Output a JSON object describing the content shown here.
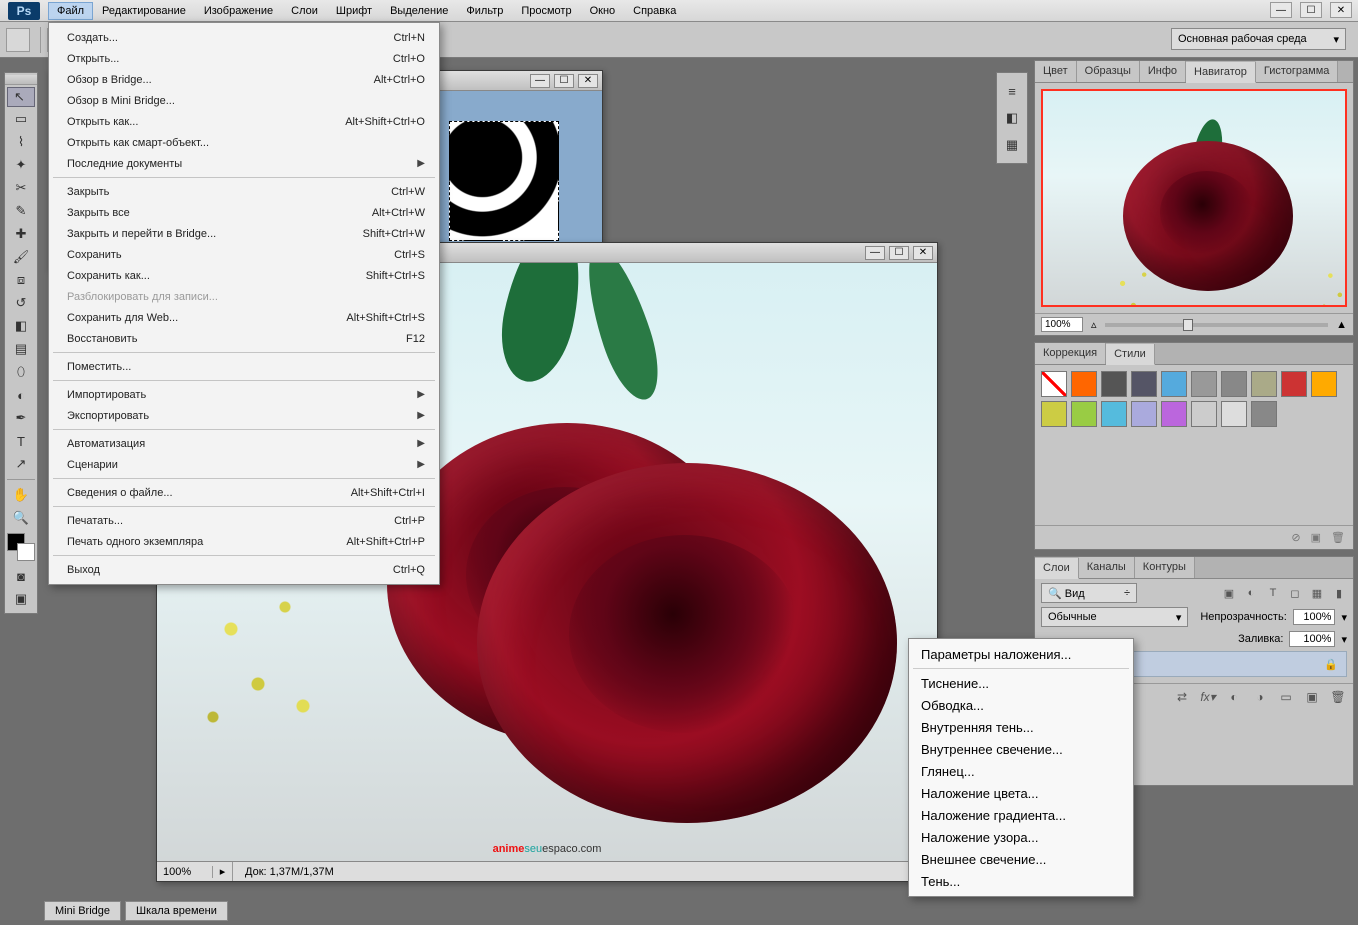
{
  "app": {
    "logo": "Ps"
  },
  "menubar": {
    "items": [
      "Файл",
      "Редактирование",
      "Изображение",
      "Слои",
      "Шрифт",
      "Выделение",
      "Фильтр",
      "Просмотр",
      "Окно",
      "Справка"
    ]
  },
  "workspace_selector": "Основная рабочая среда",
  "file_menu": [
    {
      "label": "Создать...",
      "shortcut": "Ctrl+N"
    },
    {
      "label": "Открыть...",
      "shortcut": "Ctrl+O"
    },
    {
      "label": "Обзор в Bridge...",
      "shortcut": "Alt+Ctrl+O"
    },
    {
      "label": "Обзор в Mini Bridge...",
      "shortcut": ""
    },
    {
      "label": "Открыть как...",
      "shortcut": "Alt+Shift+Ctrl+O"
    },
    {
      "label": "Открыть как смарт-объект...",
      "shortcut": ""
    },
    {
      "label": "Последние документы",
      "shortcut": "",
      "submenu": true
    },
    {
      "sep": true
    },
    {
      "label": "Закрыть",
      "shortcut": "Ctrl+W"
    },
    {
      "label": "Закрыть все",
      "shortcut": "Alt+Ctrl+W"
    },
    {
      "label": "Закрыть и перейти в Bridge...",
      "shortcut": "Shift+Ctrl+W"
    },
    {
      "label": "Сохранить",
      "shortcut": "Ctrl+S"
    },
    {
      "label": "Сохранить как...",
      "shortcut": "Shift+Ctrl+S"
    },
    {
      "label": "Разблокировать для записи...",
      "shortcut": "",
      "disabled": true
    },
    {
      "label": "Сохранить для Web...",
      "shortcut": "Alt+Shift+Ctrl+S"
    },
    {
      "label": "Восстановить",
      "shortcut": "F12"
    },
    {
      "sep": true
    },
    {
      "label": "Поместить...",
      "shortcut": ""
    },
    {
      "sep": true
    },
    {
      "label": "Импортировать",
      "shortcut": "",
      "submenu": true
    },
    {
      "label": "Экспортировать",
      "shortcut": "",
      "submenu": true
    },
    {
      "sep": true
    },
    {
      "label": "Автоматизация",
      "shortcut": "",
      "submenu": true
    },
    {
      "label": "Сценарии",
      "shortcut": "",
      "submenu": true
    },
    {
      "sep": true
    },
    {
      "label": "Сведения о файле...",
      "shortcut": "Alt+Shift+Ctrl+I"
    },
    {
      "sep": true
    },
    {
      "label": "Печатать...",
      "shortcut": "Ctrl+P"
    },
    {
      "label": "Печать одного экземпляра",
      "shortcut": "Alt+Shift+Ctrl+P"
    },
    {
      "sep": true
    },
    {
      "label": "Выход",
      "shortcut": "Ctrl+Q"
    }
  ],
  "context_menu": [
    "Параметры наложения...",
    "---",
    "Тиснение...",
    "Обводка...",
    "Внутренняя тень...",
    "Внутреннее свечение...",
    "Глянец...",
    "Наложение цвета...",
    "Наложение градиента...",
    "Наложение узора...",
    "Внешнее свечение...",
    "Тень..."
  ],
  "panels": {
    "color_tabs": [
      "Цвет",
      "Образцы",
      "Инфо",
      "Навигатор",
      "Гистограмма"
    ],
    "color_active_tab": "Навигатор",
    "nav_zoom": "100%",
    "styles_tabs": [
      "Коррекция",
      "Стили"
    ],
    "styles_active_tab": "Стили",
    "layers_tabs": [
      "Слои",
      "Каналы",
      "Контуры"
    ],
    "layers_active_tab": "Слои",
    "layers": {
      "kind_label": "Вид",
      "blend_mode": "Обычные",
      "opacity_label": "Непрозрачность:",
      "opacity_value": "100%",
      "fill_label": "Заливка:",
      "fill_value": "100%"
    }
  },
  "document": {
    "zoom": "100%",
    "info": "Док: 1,37M/1,37M",
    "watermark": {
      "a": "anime",
      "b": "seu",
      "c": "espaco.com"
    }
  },
  "bottom_tabs": [
    "Mini Bridge",
    "Шкала времени"
  ]
}
